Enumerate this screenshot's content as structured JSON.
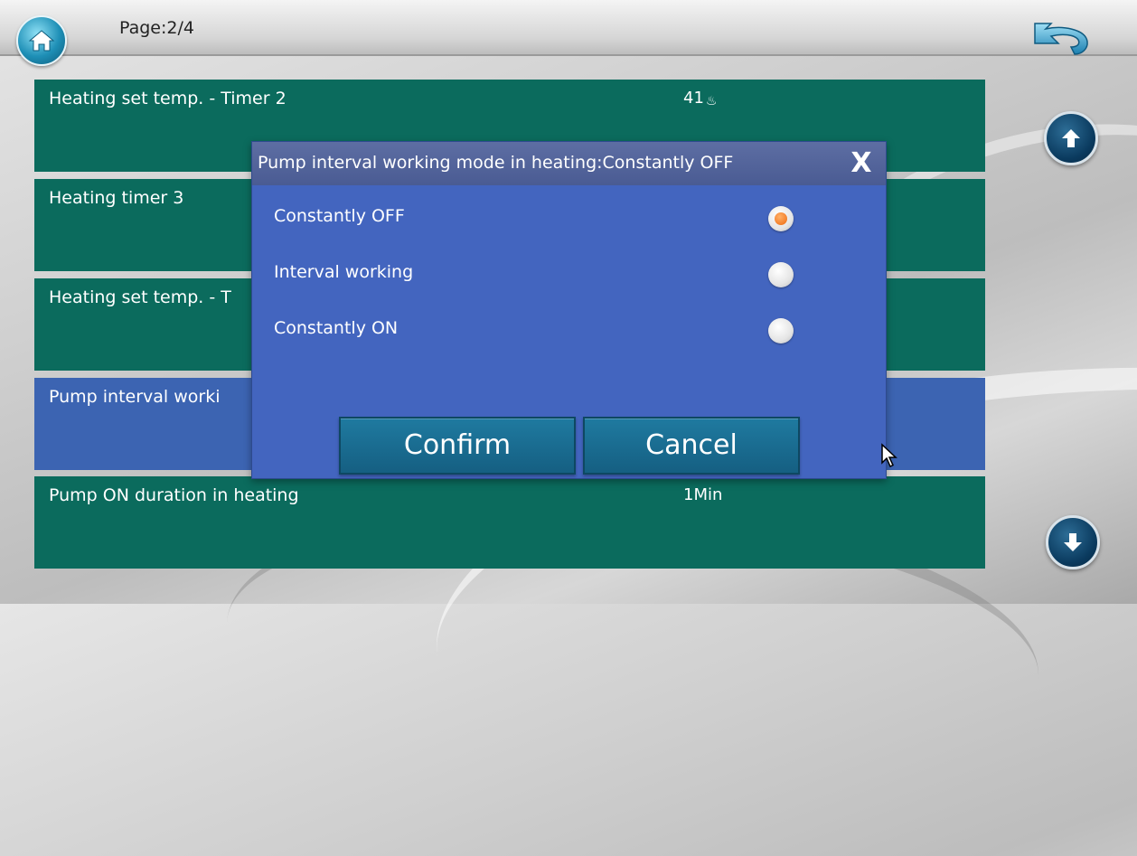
{
  "header": {
    "page_indicator": "Page:2/4",
    "home_icon": "home-icon",
    "back_icon": "undo-arrow-icon"
  },
  "rows": [
    {
      "label": "Heating set temp. - Timer 2",
      "value": "41",
      "value_icon": "temperature-unit-icon"
    },
    {
      "label": "Heating timer 3",
      "value": ""
    },
    {
      "label": "Heating set temp. - T",
      "value": ""
    },
    {
      "label": "Pump interval worki",
      "value": ""
    },
    {
      "label": "Pump ON duration in heating",
      "value": "1Min"
    }
  ],
  "scroll": {
    "up_icon": "arrow-up-icon",
    "down_icon": "arrow-down-icon"
  },
  "dialog": {
    "title": "Pump interval working mode in heating:Constantly OFF",
    "close_label": "X",
    "options": [
      {
        "label": "Constantly OFF",
        "selected": true
      },
      {
        "label": "Interval working",
        "selected": false
      },
      {
        "label": "Constantly ON",
        "selected": false
      }
    ],
    "confirm_label": "Confirm",
    "cancel_label": "Cancel"
  },
  "colors": {
    "row_bg": "#0b6b5d",
    "row_selected_bg": "#3c64b2",
    "dialog_bg": "#4365bf",
    "button_bg": "#1f7aa0",
    "radio_selected": "#ee6a0f"
  }
}
